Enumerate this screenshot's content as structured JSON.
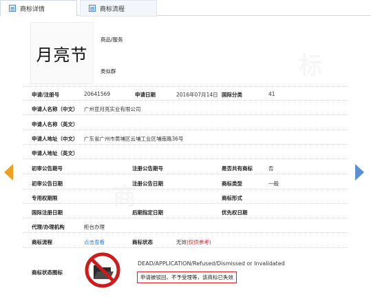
{
  "tabs": [
    {
      "label": "商标详情"
    },
    {
      "label": "商标流程"
    }
  ],
  "trademark": {
    "mark_text": "月亮节",
    "goods_services_label": "商品/服务",
    "similar_group_label": "类似群"
  },
  "fields": {
    "reg_no_label": "申请/注册号",
    "reg_no_value": "20641569",
    "apply_date_label": "申请日期",
    "apply_date_value": "2016年07月14日",
    "intl_class_label": "国际分类",
    "intl_class_value": "41",
    "applicant_cn_label": "申请人名称（中文）",
    "applicant_cn_value": "广州亚月亮实业有限公司",
    "applicant_en_label": "申请人名称（英文）",
    "address_cn_label": "申请人地址（中文）",
    "address_cn_value": "广东省广州市黄埔区云埔工业区埔南路36号",
    "address_en_label": "申请人地址（英文）",
    "prelim_pub_no_label": "初审公告期号",
    "reg_pub_no_label": "注册公告期号",
    "shared_label": "是否共有商标",
    "shared_value": "否",
    "prelim_pub_date_label": "初审公告日期",
    "reg_pub_date_label": "注册公告日期",
    "mark_type_label": "商标类型",
    "mark_type_value": "一般",
    "exclusive_period_label": "专用权期限",
    "mark_form_label": "商标形式",
    "intl_reg_date_label": "国际注册日期",
    "later_designation_label": "后期指定日期",
    "priority_date_label": "优先权日期",
    "agent_label": "代理/办理机构",
    "agent_value": "柜台办理",
    "process_label": "商标流程",
    "process_link": "点击查看",
    "status_label": "商标状态",
    "status_value": "无效",
    "status_note": "(仅供参考)",
    "status_icon_label": "商标状态图标",
    "status_en": "DEAD/APPLICATION/Refused/Dismissed or Invalidated",
    "status_cn": "申请被驳回、不予受理等，该商标已失效"
  },
  "colors": {
    "link": "#2a7fc8",
    "warning": "#d02020",
    "arrow_left": "#f0a020",
    "arrow_right": "#5a8fd0"
  }
}
